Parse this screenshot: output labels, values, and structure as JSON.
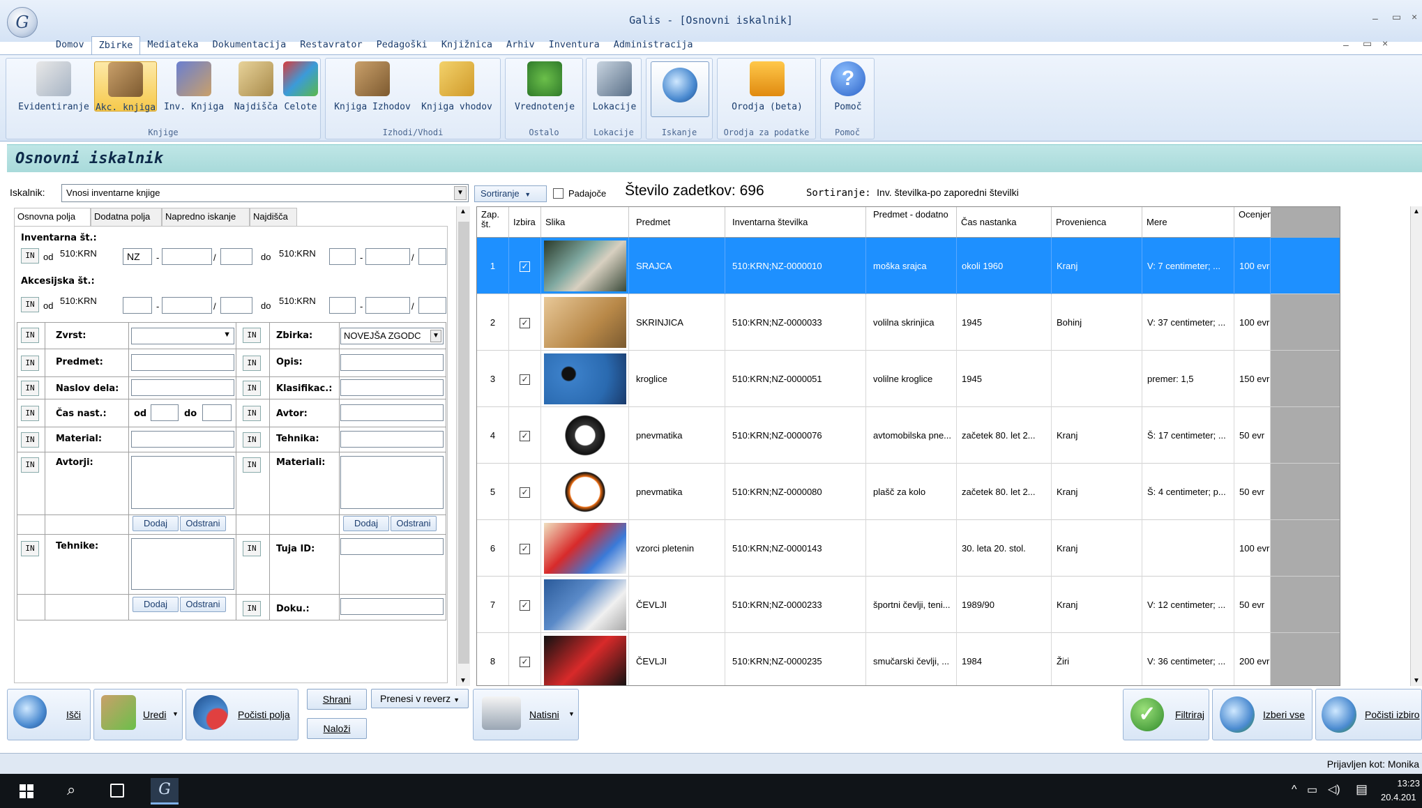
{
  "window": {
    "title": "Galis - [Osnovni iskalnik]"
  },
  "menu": [
    "Domov",
    "Zbirke",
    "Mediateka",
    "Dokumentacija",
    "Restavrator",
    "Pedagoški",
    "Knjižnica",
    "Arhiv",
    "Inventura",
    "Administracija"
  ],
  "ribbon": {
    "groups": [
      {
        "label": "Knjige",
        "buttons": [
          "Evidentiranje",
          "Akc. knjiga",
          "Inv. Knjiga",
          "Najdišča",
          "Celote"
        ]
      },
      {
        "label": "Izhodi/Vhodi",
        "buttons": [
          "Knjiga Izhodov",
          "Knjiga vhodov"
        ]
      },
      {
        "label": "Ostalo",
        "buttons": [
          "Vrednotenje"
        ]
      },
      {
        "label": "Lokacije",
        "buttons": [
          "Lokacije"
        ]
      },
      {
        "label": "Iskanje",
        "buttons": [
          ""
        ]
      },
      {
        "label": "Orodja za podatke",
        "buttons": [
          "Orodja (beta)"
        ]
      },
      {
        "label": "Pomoč",
        "buttons": [
          "Pomoč"
        ]
      }
    ]
  },
  "section_title": "Osnovni iskalnik",
  "search": {
    "label": "Iskalnik:",
    "value": "Vnosi inventarne knjige",
    "tabs": [
      "Osnovna polja",
      "Dodatna polja",
      "Napredno iskanje",
      "Najdišča"
    ],
    "inv_label": "Inventarna št.:",
    "akc_label": "Akcesijska št.:",
    "in": "IN",
    "od": "od",
    "do": "do",
    "prefix": "510:KRN",
    "nz": "NZ",
    "dash": "-",
    "slash": "/",
    "fields_left": [
      "Zvrst:",
      "Predmet:",
      "Naslov dela:",
      "Čas nast.:",
      "Material:",
      "Avtorji:",
      "Tehnike:"
    ],
    "fields_right": [
      "Zbirka:",
      "Opis:",
      "Klasifikac.:",
      "Avtor:",
      "Tehnika:",
      "Materiali:",
      "Tuja ID:",
      "Doku.:"
    ],
    "zbirka_value": "NOVEJŠA ZGODC",
    "dodaj": "Dodaj",
    "odstrani": "Odstrani"
  },
  "toolbar": {
    "sortiranje_btn": "Sortiranje",
    "padajoce": "Padajoče",
    "count_label": "Število zadetkov:",
    "count": "696",
    "sort_label": "Sortiranje:",
    "sort_value": "Inv. številka-po zaporedni številki"
  },
  "table": {
    "headers": [
      "Zap. št.",
      "Izbira",
      "Slika",
      "Predmet",
      "Inventarna številka",
      "Predmet - dodatno",
      "Čas nastanka",
      "Provenienca",
      "Mere",
      "Ocenjena vrednost"
    ],
    "rows": [
      [
        "1",
        "SRAJCA",
        "510:KRN;NZ-0000010",
        "moška srajca",
        "okoli 1960",
        "Kranj",
        "V: 7 centimeter; ...",
        "100 evr"
      ],
      [
        "2",
        "SKRINJICA",
        "510:KRN;NZ-0000033",
        "volilna skrinjica",
        "1945",
        "Bohinj",
        "V: 37 centimeter; ...",
        "100 evr"
      ],
      [
        "3",
        "kroglice",
        "510:KRN;NZ-0000051",
        "volilne kroglice",
        "1945",
        "",
        "premer: 1,5",
        "150 evr"
      ],
      [
        "4",
        "pnevmatika",
        "510:KRN;NZ-0000076",
        "avtomobilska pne...",
        "začetek 80. let 2...",
        "Kranj",
        "Š: 17 centimeter; ...",
        "50 evr"
      ],
      [
        "5",
        "pnevmatika",
        "510:KRN;NZ-0000080",
        "plašč za kolo",
        "začetek 80. let 2...",
        "Kranj",
        "Š: 4 centimeter; p...",
        "50 evr"
      ],
      [
        "6",
        "vzorci pletenin",
        "510:KRN;NZ-0000143",
        "",
        "30. leta 20. stol.",
        "Kranj",
        "",
        "100 evr"
      ],
      [
        "7",
        "ČEVLJI",
        "510:KRN;NZ-0000233",
        "športni čevlji, teni...",
        "1989/90",
        "Kranj",
        "V: 12 centimeter; ...",
        "50 evr"
      ],
      [
        "8",
        "ČEVLJI",
        "510:KRN;NZ-0000235",
        "smučarski čevlji, ...",
        "1984",
        "Žiri",
        "V: 36 centimeter; ...",
        "200 evr"
      ]
    ]
  },
  "bottom": {
    "isci": "Išči",
    "uredi": "Uredi",
    "pocisti_polja": "Počisti polja",
    "shrani": "Shrani",
    "nalozi": "Naloži",
    "prenesi": "Prenesi v reverz",
    "natisni": "Natisni",
    "filtriraj": "Filtriraj",
    "izberi_vse": "Izberi vse",
    "pocisti_izbiro": "Počisti izbiro"
  },
  "status": {
    "logged_in": "Prijavljen kot: Monika"
  },
  "taskbar": {
    "time": "13:23",
    "date": "20.4.201"
  }
}
